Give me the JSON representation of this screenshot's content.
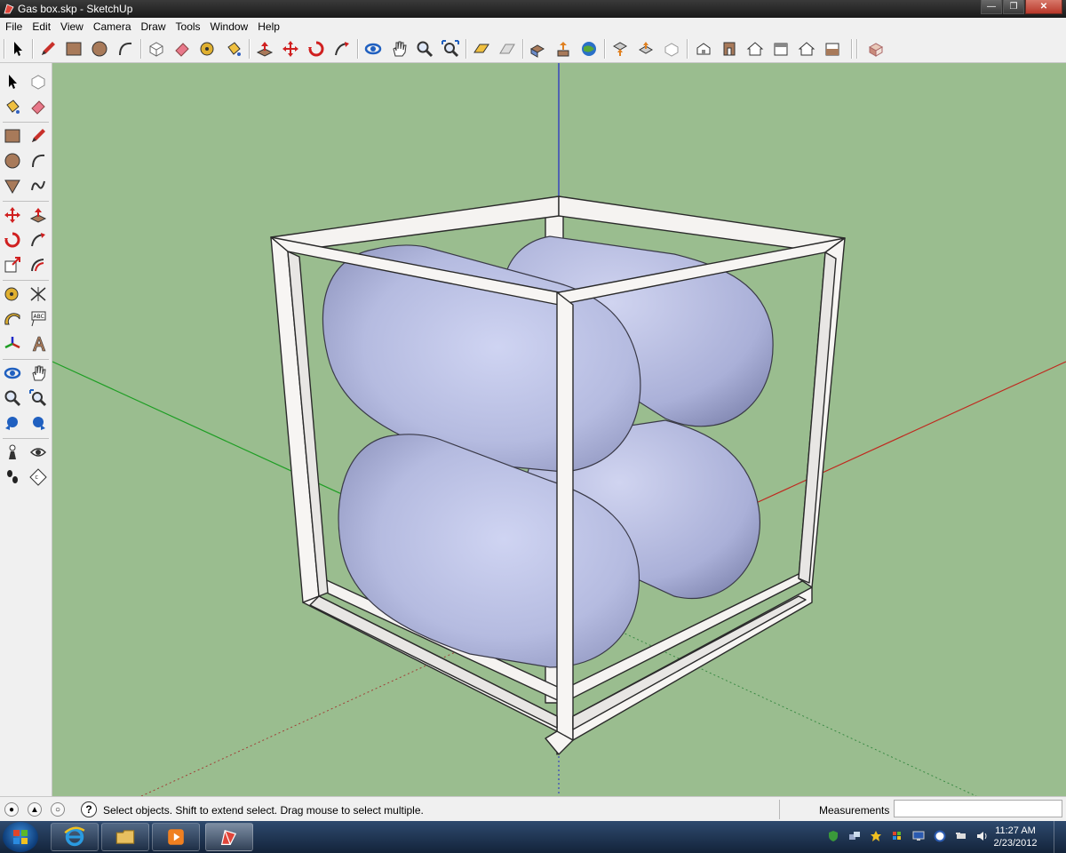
{
  "window": {
    "title": "Gas box.skp - SketchUp",
    "app_icon": "sketchup-icon"
  },
  "window_controls": {
    "minimize": "minimize-icon",
    "maximize": "restore-icon",
    "close": "close-icon"
  },
  "menu": [
    "File",
    "Edit",
    "View",
    "Camera",
    "Draw",
    "Tools",
    "Window",
    "Help"
  ],
  "toolbar_icons": [
    "select-icon",
    "pencil-icon",
    "rectangle-icon",
    "circle-icon",
    "arc-icon",
    "make-component-icon",
    "eraser-icon",
    "tape-measure-icon",
    "paint-bucket-icon",
    "push-pull-icon",
    "move-icon",
    "rotate-icon",
    "follow-me-icon",
    "orbit-icon",
    "pan-icon",
    "zoom-icon",
    "zoom-extents-icon",
    "add-location-icon",
    "toggle-terrain-icon",
    "get-models-icon",
    "share-model-icon",
    "google-earth-icon",
    "get-components-icon",
    "share-component-icon",
    "3d-warehouse-icon",
    "iso-view-icon",
    "front-view-icon",
    "top-view-icon",
    "right-view-icon",
    "back-view-icon",
    "left-view-icon",
    "model-info-icon"
  ],
  "left_toolbar_icons": [
    "select-icon",
    "make-component-icon",
    "paint-bucket-icon",
    "eraser-icon",
    "rectangle-icon",
    "pencil-icon",
    "circle-icon",
    "arc-icon",
    "polygon-icon",
    "freehand-icon",
    "move-icon",
    "push-pull-icon",
    "rotate-icon",
    "follow-me-icon",
    "scale-icon",
    "offset-icon",
    "tape-measure-icon",
    "dimension-icon",
    "protractor-icon",
    "text-icon",
    "axes-icon",
    "3d-text-icon",
    "orbit-icon",
    "pan-icon",
    "zoom-icon",
    "zoom-window-icon",
    "previous-view-icon",
    "next-view-icon",
    "position-camera-icon",
    "look-around-icon",
    "walk-icon",
    "section-plane-icon"
  ],
  "status": {
    "help_text": "Select objects. Shift to extend select. Drag mouse to select multiple.",
    "geo_icon": "geo-location-icon",
    "credits_icon": "credits-icon",
    "user_icon": "user-icon",
    "help_icon": "help-icon",
    "measurements_label": "Measurements",
    "measurements_value": ""
  },
  "taskbar": {
    "start_icon": "windows-start-icon",
    "apps": [
      "internet-explorer-icon",
      "file-explorer-icon",
      "media-player-icon",
      "sketchup-icon"
    ],
    "tray": [
      "security-icon",
      "network-icon",
      "star-icon",
      "flag-icon",
      "display-icon",
      "updates-icon",
      "power-icon",
      "volume-icon"
    ],
    "time": "11:27 AM",
    "date": "2/23/2012"
  },
  "colors": {
    "viewport_background": "#9abd8f",
    "tank_fill": "#b9bfe4",
    "frame_fill": "#f7f5f3",
    "axis_red": "#c0281e",
    "axis_green": "#1e9e24",
    "axis_blue": "#1e28c8"
  }
}
